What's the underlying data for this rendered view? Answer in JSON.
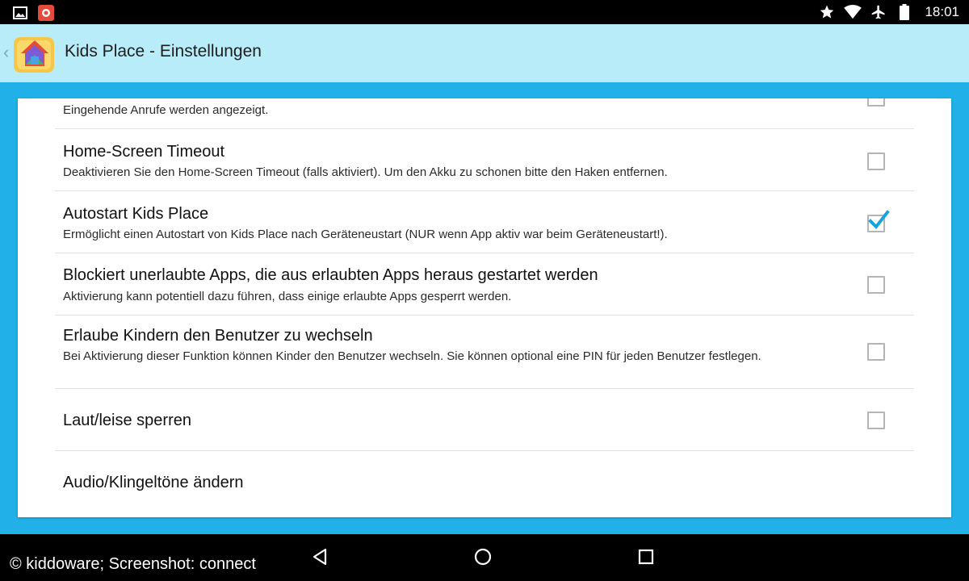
{
  "status_bar": {
    "left_icons": [
      "gallery-icon",
      "notification-app-icon"
    ],
    "right_icons": [
      "star-icon",
      "wifi-icon",
      "airplane-mode-icon",
      "battery-icon"
    ],
    "time": "18:01"
  },
  "action_bar": {
    "title": "Kids Place - Einstellungen",
    "icon": "kids-place-app-icon",
    "background": "#b9ecf9"
  },
  "settings": {
    "partial_row": {
      "summary": "Eingehende Anrufe werden angezeigt.",
      "checked": false
    },
    "items": [
      {
        "title": "Home-Screen Timeout",
        "summary": "Deaktivieren Sie den Home-Screen Timeout (falls aktiviert). Um den Akku zu schonen bitte den Haken entfernen.",
        "checked": false
      },
      {
        "title": "Autostart Kids Place",
        "summary": "Ermöglicht einen Autostart von Kids Place nach Geräteneustart (NUR wenn App aktiv war beim Geräteneustart!).",
        "checked": true
      },
      {
        "title": "Blockiert unerlaubte Apps, die aus erlaubten Apps heraus gestartet werden",
        "summary": "Aktivierung kann potentiell dazu führen, dass einige erlaubte Apps gesperrt werden.",
        "checked": false
      },
      {
        "title": "Erlaube Kindern den Benutzer zu wechseln",
        "summary": "Bei Aktivierung dieser Funktion können Kinder den Benutzer wechseln. Sie können optional eine PIN für jeden Benutzer festlegen.",
        "checked": false
      },
      {
        "title": "Laut/leise sperren",
        "summary": "",
        "checked": false
      },
      {
        "title": "Audio/Klingeltöne ändern",
        "summary": ""
      }
    ]
  },
  "nav_bar": {
    "credit": "© kiddoware; Screenshot: connect",
    "buttons": [
      "back-icon",
      "home-icon",
      "recents-icon"
    ]
  },
  "colors": {
    "accent": "#21b0e8",
    "checkbox_check": "#1aa3d8"
  }
}
